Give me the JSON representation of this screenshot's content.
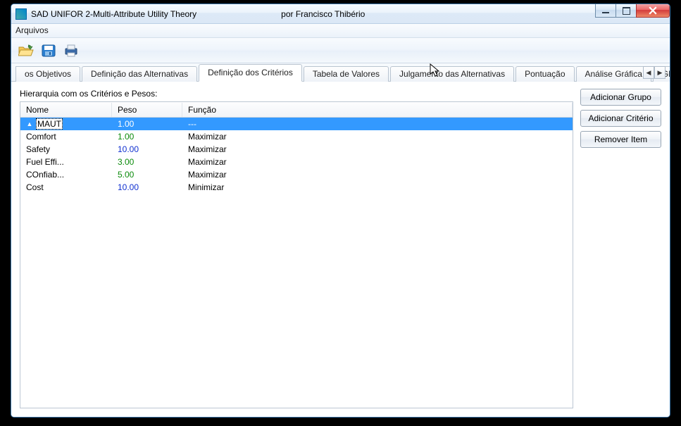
{
  "window": {
    "title_main": "SAD UNIFOR 2-Multi-Attribute Utility Theory",
    "title_secondary": "por Francisco Thibério"
  },
  "menu": {
    "arquivos": "Arquivos"
  },
  "toolbar": {
    "open_icon": "open-file-icon",
    "save_icon": "save-icon",
    "print_icon": "print-icon"
  },
  "tabs": {
    "t0": "os Objetivos",
    "t1": "Definição das Alternativas",
    "t2": "Definição dos Critérios",
    "t3": "Tabela de Valores",
    "t4": "Julgamento das Alternativas",
    "t5": "Pontuação",
    "t6": "Análise Gráfica",
    "t7": "Glossário"
  },
  "panel": {
    "hierarchy_label": "Hierarquia com os Critérios e Pesos:",
    "columns": {
      "nome": "Nome",
      "peso": "Peso",
      "funcao": "Função"
    },
    "rows": [
      {
        "name": "MAUT",
        "peso": "1.00",
        "funcao": "---",
        "indent": 0,
        "selected": true,
        "peso_color": "white",
        "expander": "▲"
      },
      {
        "name": "Comfort",
        "peso": "1.00",
        "funcao": "Maximizar",
        "indent": 1,
        "selected": false,
        "peso_color": "green"
      },
      {
        "name": "Safety",
        "peso": "10.00",
        "funcao": "Maximizar",
        "indent": 1,
        "selected": false,
        "peso_color": "blue"
      },
      {
        "name": "Fuel Effi...",
        "peso": "3.00",
        "funcao": "Maximizar",
        "indent": 1,
        "selected": false,
        "peso_color": "green"
      },
      {
        "name": "COnfiab...",
        "peso": "5.00",
        "funcao": "Maximizar",
        "indent": 1,
        "selected": false,
        "peso_color": "green"
      },
      {
        "name": "Cost",
        "peso": "10.00",
        "funcao": "Minimizar",
        "indent": 1,
        "selected": false,
        "peso_color": "blue"
      }
    ]
  },
  "actions": {
    "add_group": "Adicionar Grupo",
    "add_criterion": "Adicionar Critério",
    "remove_item": "Remover Item"
  }
}
